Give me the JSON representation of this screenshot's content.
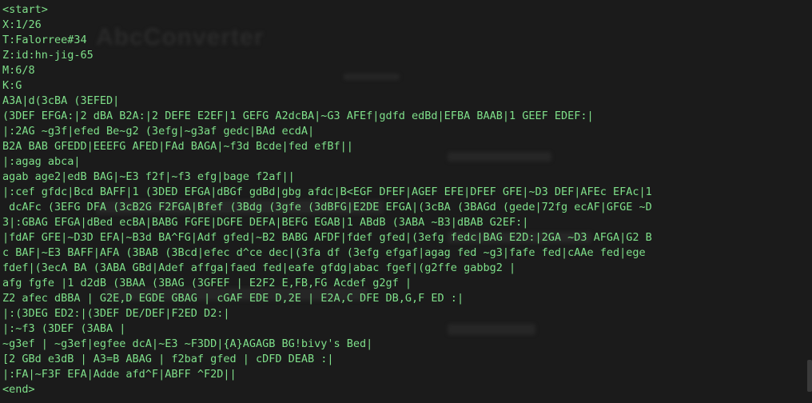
{
  "background_title": "AbcConverter",
  "lines": [
    "<start>",
    "X:1/26",
    "T:Falorree#34",
    "Z:id:hn-jig-65",
    "M:6/8",
    "K:G",
    "A3A|d(3cBA (3EFED|",
    "(3DEF EFGA:|2 dBA B2A:|2 DEFE E2EF|1 GEFG A2dcBA|~G3 AFEf|gdfd edBd|EFBA BAAB|1 GEEF EDEF:|",
    "|:2AG ~g3f|efed Be~g2 (3efg|~g3af gedc|BAd ecdA|",
    "B2A BAB GFEDD|EEEFG AFED|FAd BAGA|~f3d Bcde|fed efBf||",
    "|:agag abca|",
    "agab age2|edB BAG|~E3 f2f|~f3 efg|bage f2af||",
    "|:cef gfdc|Bcd BAFF|1 (3DED EFGA|dBGf gdBd|gbg afdc|B<EGF DFEF|AGEF EFE|DFEF GFE|~D3 DEF|AFEc EFAc|1",
    " dcAFc (3EFG DFA (3cB2G F2FGA|Bfef (3Bdg (3gfe (3dBFG|E2DE EFGA|(3cBA (3BAGd (gede|72fg ecAF|GFGE ~D",
    "3|:GBAG EFGA|dBed ecBA|BABG FGFE|DGFE DEFA|BEFG EGAB|1 ABdB (3ABA ~B3|dBAB G2EF:|",
    "|fdAF GFE|~D3D EFA|~B3d BA^FG|Adf gfed|~B2 BABG AFDF|fdef gfed|(3efg fedc|BAG E2D:|2GA ~D3 AFGA|G2 B",
    "c BAF|~E3 BAFF|AFA (3BAB (3Bcd|efec d^ce dec|(3fa df (3efg efgaf|agag fed ~g3|fafe fed|cAAe fed|ege",
    "fdef|(3ecA BA (3ABA GBd|Adef affga|faed fed|eafe gfdg|abac fgef|(g2ffe gabbg2 |",
    "afg fgfe |1 d2dB (3BAA (3BAG (3GFEF | E2F2 E,FB,FG Acdef g2gf |",
    "Z2 afec dBBA | G2E,D EGDE GBAG | cGAF EDE D,2E | E2A,C DFE DB,G,F ED :|",
    "|:(3DEG ED2:|(3DEF DE/DEF|F2ED D2:|",
    "|:~f3 (3DEF (3ABA |",
    "~g3ef | ~g3ef|egfee dcA|~E3 ~F3DD|{A}AGAGB BG!bivy's Bed|",
    "[2 GBd e3dB | A3=B ABAG | f2baf gfed | cDFD DEAB :|",
    "|:FA|~F3F EFA|Adde afd^F|ABFF ^F2D||",
    "<end>"
  ]
}
